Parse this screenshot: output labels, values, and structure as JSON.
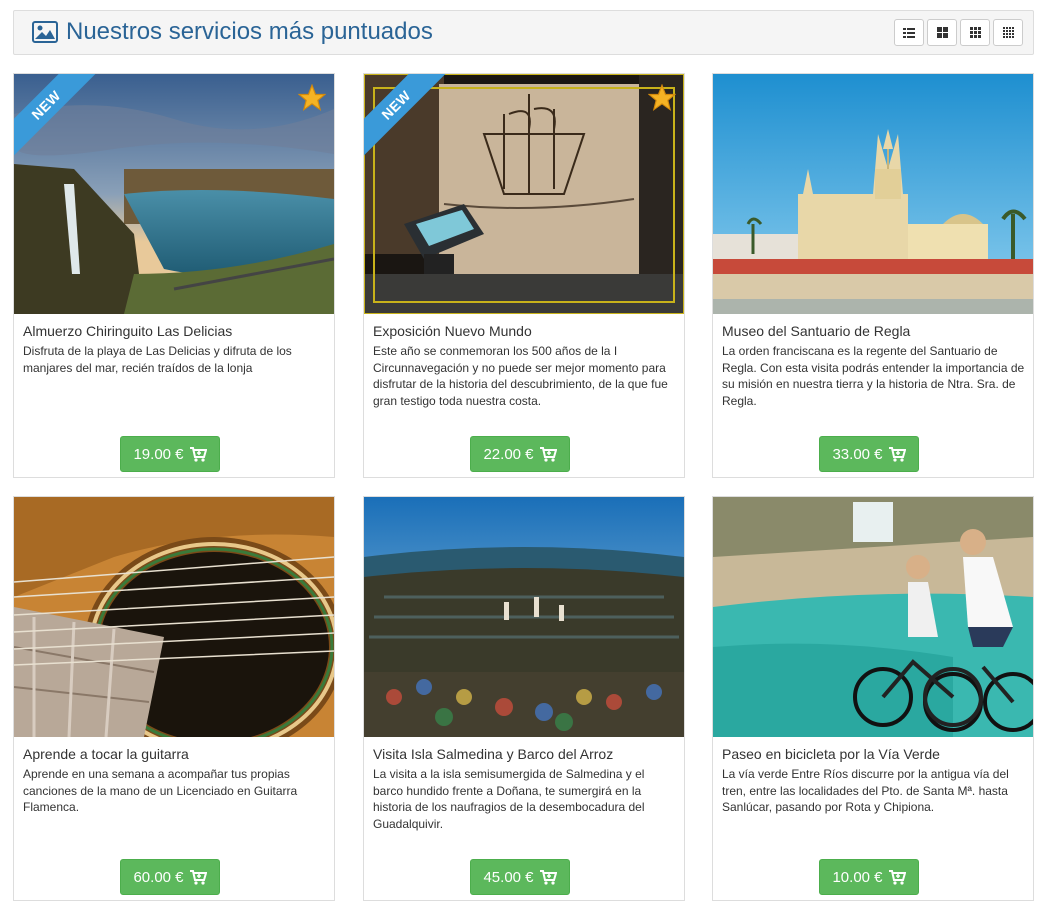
{
  "header": {
    "title": "Nuestros servicios más puntuados",
    "icon": "picture-icon",
    "view_buttons": [
      "list-view-icon",
      "grid-2-icon",
      "grid-3-icon",
      "grid-4-icon"
    ]
  },
  "ribbon_label": "NEW",
  "services": [
    {
      "name": "Almuerzo Chiringuito Las Delicias",
      "description": "Disfruta de la playa de Las Delicias y difruta de los manjares del mar, recién traídos de la lonja",
      "price": "19.00 €",
      "new": true,
      "featured": true
    },
    {
      "name": "Exposición Nuevo Mundo",
      "description": "Este año se conmemoran los 500 años de la I Circunnavegación y no puede ser mejor momento para disfrutar de la historia del descubrimiento, de la que fue gran testigo toda nuestra costa.",
      "price": "22.00 €",
      "new": true,
      "featured": true
    },
    {
      "name": "Museo del Santuario de Regla",
      "description": "La orden franciscana es la regente del Santuario de Regla. Con esta visita podrás entender la importancia de su misión en nuestra tierra y la historia de Ntra. Sra. de Regla.",
      "price": "33.00 €",
      "new": false,
      "featured": false
    },
    {
      "name": "Aprende a tocar la guitarra",
      "description": "Aprende en una semana a acompañar tus propias canciones de la mano de un Licenciado en Guitarra Flamenca.",
      "price": "60.00 €",
      "new": false,
      "featured": false
    },
    {
      "name": "Visita Isla Salmedina y Barco del Arroz",
      "description": "La visita a la isla semisumergida de Salmedina y el barco hundido frente a Doñana, te sumergirá en la historia de los naufragios de la desembocadura del Guadalquivir.",
      "price": "45.00 €",
      "new": false,
      "featured": false
    },
    {
      "name": "Paseo en bicicleta por la Vía Verde",
      "description": "La vía verde Entre Ríos discurre por la antigua vía del tren, entre las localidades del Pto. de Santa Mª. hasta Sanlúcar, pasando por Rota y Chipiona.",
      "price": "10.00 €",
      "new": false,
      "featured": false
    }
  ],
  "colors": {
    "title": "#2a6496",
    "button": "#5cb85c",
    "ribbon": "#3a9ad9"
  }
}
